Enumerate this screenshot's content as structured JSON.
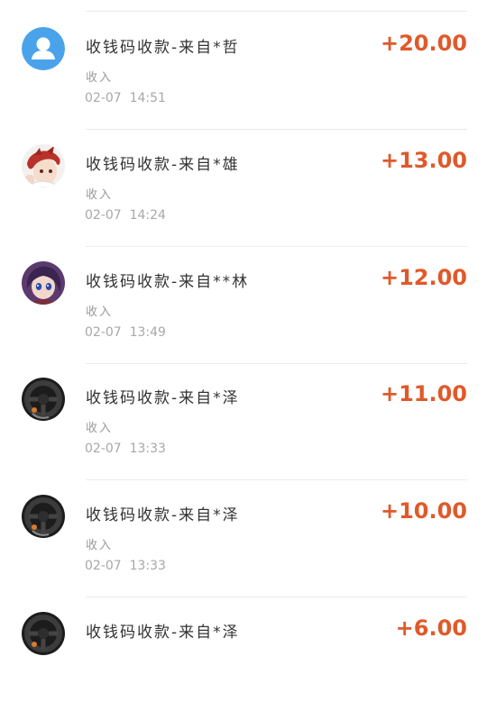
{
  "colors": {
    "amount": "#e0592a",
    "title": "#333333",
    "meta": "#9a9a9a"
  },
  "transactions": [
    {
      "title": "收钱码收款-来自*哲",
      "type": "收入",
      "time": "02-07  14:51",
      "amount": "+20.00",
      "avatar_icon": "default-user-icon"
    },
    {
      "title": "收钱码收款-来自*雄",
      "type": "收入",
      "time": "02-07  14:24",
      "amount": "+13.00",
      "avatar_icon": "anime-redhair-avatar"
    },
    {
      "title": "收钱码收款-来自**林",
      "type": "收入",
      "time": "02-07  13:49",
      "amount": "+12.00",
      "avatar_icon": "anime-purplehair-avatar"
    },
    {
      "title": "收钱码收款-来自*泽",
      "type": "收入",
      "time": "02-07  13:33",
      "amount": "+11.00",
      "avatar_icon": "steering-wheel-avatar"
    },
    {
      "title": "收钱码收款-来自*泽",
      "type": "收入",
      "time": "02-07  13:33",
      "amount": "+10.00",
      "avatar_icon": "steering-wheel-avatar"
    },
    {
      "title": "收钱码收款-来自*泽",
      "type": "收入",
      "time": "",
      "amount": "+6.00",
      "avatar_icon": "steering-wheel-avatar"
    }
  ]
}
